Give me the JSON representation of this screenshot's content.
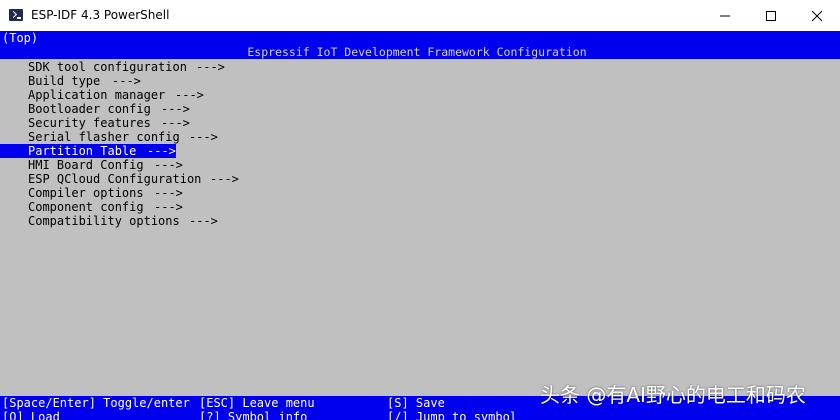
{
  "window": {
    "title": "ESP-IDF 4.3 PowerShell",
    "icon": "powershell-icon",
    "controls": [
      "minimize-icon",
      "maximize-icon",
      "close-icon"
    ]
  },
  "terminal": {
    "scroll_indicator": "(Top)",
    "header": "Espressif IoT Development Framework Configuration",
    "arrow": "--->",
    "selected_index": 6,
    "menu_items": [
      "SDK tool configuration",
      "Build type",
      "Application manager",
      "Bootloader config",
      "Security features",
      "Serial flasher config",
      "Partition Table",
      "HMI Board Config",
      "ESP QCloud Configuration",
      "Compiler options",
      "Component config",
      "Compatibility options"
    ],
    "keybindings": [
      "[Space/Enter] Toggle/enter",
      "[ESC] Leave menu",
      "[S] Save",
      "[O] Load",
      "[?] Symbol info",
      "[/] Jump to symbol"
    ]
  },
  "watermark": "头条 @有AI野心的电工和码农",
  "colors": {
    "terminal_bg": "#c0c0c0",
    "bar_bg": "#0000ee",
    "text": "#000000",
    "inverse_text": "#ffffff"
  }
}
